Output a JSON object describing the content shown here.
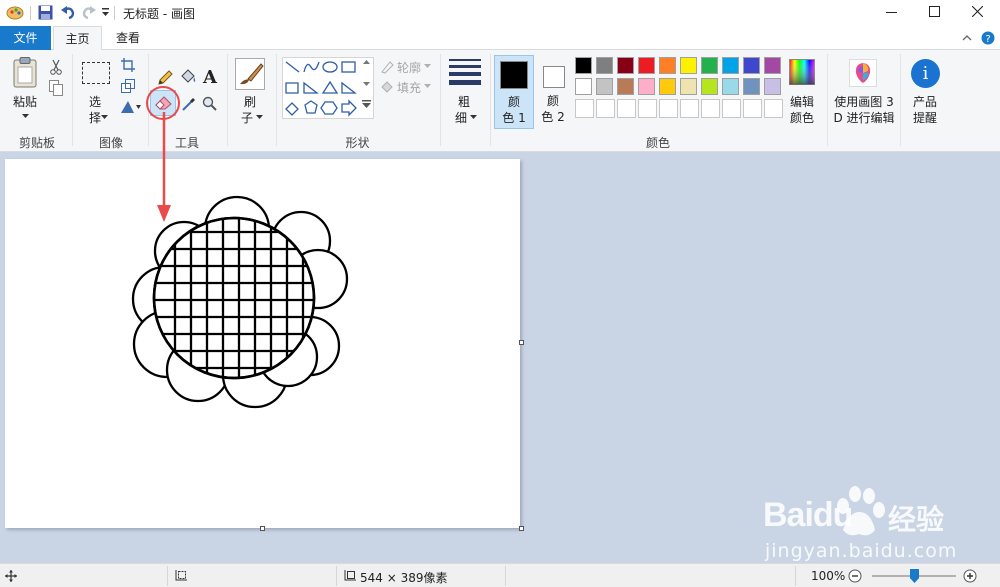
{
  "window": {
    "title": "无标题 - 画图"
  },
  "tabs": [
    {
      "label": "文件"
    },
    {
      "label": "主页"
    },
    {
      "label": "查看"
    }
  ],
  "clipboard": {
    "paste_label": "粘贴",
    "group_label": "剪贴板"
  },
  "image": {
    "select_label_1": "选",
    "select_label_2": "择",
    "group_label": "图像"
  },
  "tools": {
    "group_label": "工具",
    "text_glyph": "A"
  },
  "brushes": {
    "label_1": "刷",
    "label_2": "子"
  },
  "shapes": {
    "outline_label": "轮廓",
    "fill_label": "填充",
    "group_label": "形状"
  },
  "size": {
    "label_1": "粗",
    "label_2": "细"
  },
  "colors": {
    "color1_label_1": "颜",
    "color1_label_2": "色 1",
    "color1_value": "#000000",
    "color2_label_1": "颜",
    "color2_label_2": "色 2",
    "color2_value": "#ffffff",
    "group_label": "颜色",
    "palette_row1": [
      "#000000",
      "#7f7f7f",
      "#880015",
      "#ed1c24",
      "#ff7f27",
      "#fff200",
      "#22b14c",
      "#00a2e8",
      "#3f48cc",
      "#a349a4"
    ],
    "palette_row2": [
      "#ffffff",
      "#c3c3c3",
      "#b97a57",
      "#ffaec9",
      "#ffc90e",
      "#efe4b0",
      "#b5e61d",
      "#99d9ea",
      "#7092be",
      "#c8bfe7"
    ],
    "edit_label_1": "编辑",
    "edit_label_2": "颜色"
  },
  "paint3d": {
    "label_1": "使用画图 3",
    "label_2": "D 进行编辑"
  },
  "product": {
    "label_1": "产品",
    "label_2": "提醒",
    "glyph": "i"
  },
  "status": {
    "dimensions": "544 × 389像素",
    "zoom": "100%",
    "zoom_level": 1.0
  },
  "watermark": {
    "brand": "Baidu",
    "brand_cn": "经验",
    "url": "jingyan.baidu.com"
  }
}
